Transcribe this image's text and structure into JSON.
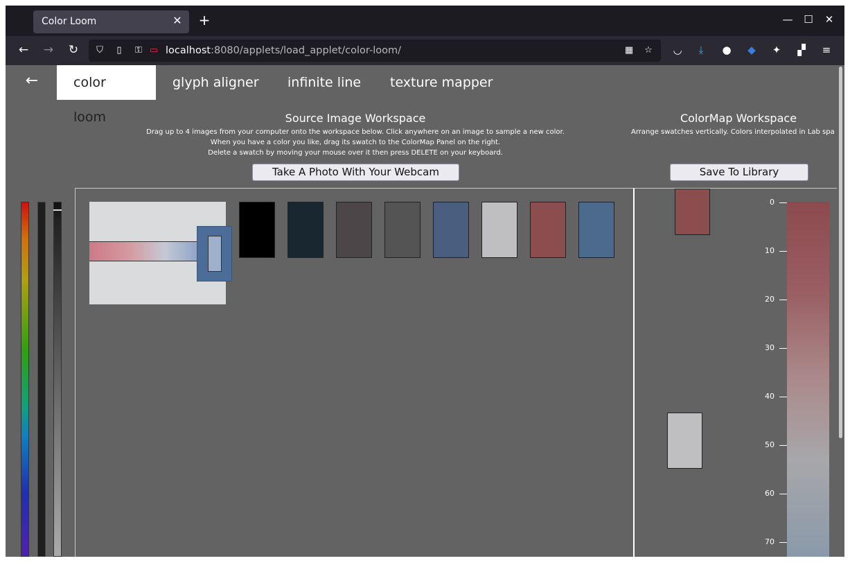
{
  "browser": {
    "tab_title": "Color Loom",
    "tab_close": "✕",
    "new_tab": "+",
    "window_controls": [
      "—",
      "☐",
      "✕"
    ],
    "url_host": "localhost",
    "url_rest": ":8080/applets/load_applet/color-loom/"
  },
  "app": {
    "back": "←",
    "tabs": [
      {
        "label": "color loom",
        "active": true
      },
      {
        "label": "glyph aligner",
        "active": false
      },
      {
        "label": "infinite line",
        "active": false
      },
      {
        "label": "texture mapper",
        "active": false
      }
    ]
  },
  "source_workspace": {
    "title": "Source Image Workspace",
    "instructions": [
      "Drag up to 4 images from your computer onto the workspace below.  Click anywhere on an image to sample a new color.",
      "When you have a color you like, drag its swatch to the ColorMap Panel on the right.",
      "Delete a swatch by moving your mouse over it then press DELETE on your keyboard."
    ],
    "webcam_button": "Take A Photo With Your Webcam",
    "swatches": [
      "#000000",
      "#192830",
      "#4c4648",
      "#545454",
      "#4a5e80",
      "#bfbfc1",
      "#8c4d4e",
      "#4b6a8c"
    ],
    "sampler_color": "#4c6d97"
  },
  "colormap_workspace": {
    "title": "ColorMap Workspace",
    "instruction": "Arrange swatches vertically. Colors interpolated in Lab spa",
    "save_button": "Save To Library",
    "swatches": [
      "#8c4d4e",
      "#bfbfc1"
    ],
    "axis_ticks": [
      "0",
      "10",
      "20",
      "30",
      "40",
      "50",
      "60",
      "70"
    ]
  }
}
